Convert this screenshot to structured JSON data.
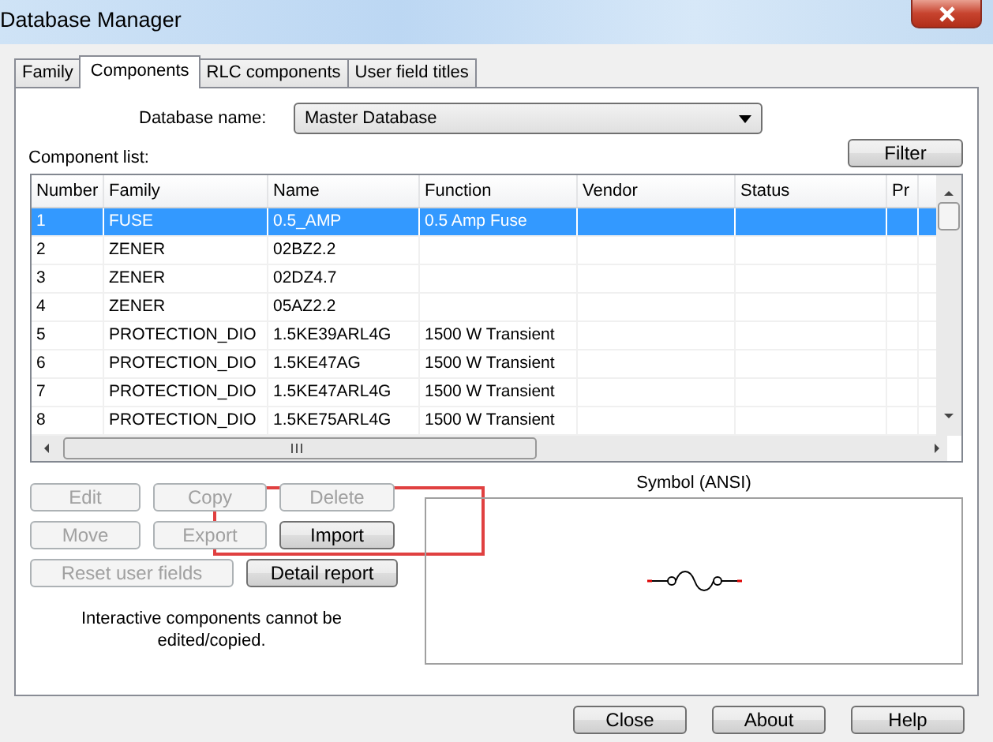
{
  "window": {
    "title": "Database Manager"
  },
  "tabs": [
    {
      "label": "Family",
      "selected": false
    },
    {
      "label": "Components",
      "selected": true
    },
    {
      "label": "RLC components",
      "selected": false
    },
    {
      "label": "User field titles",
      "selected": false
    }
  ],
  "database": {
    "label": "Database name:",
    "value": "Master Database"
  },
  "filter_button": "Filter",
  "component_list": {
    "label": "Component list:",
    "columns": [
      "Number",
      "Family",
      "Name",
      "Function",
      "Vendor",
      "Status",
      "Pr"
    ],
    "rows": [
      {
        "cells": [
          "1",
          "FUSE",
          "0.5_AMP",
          "0.5 Amp Fuse",
          "",
          "",
          ""
        ],
        "selected": true
      },
      {
        "cells": [
          "2",
          "ZENER",
          "02BZ2.2",
          "",
          "",
          "",
          ""
        ],
        "selected": false
      },
      {
        "cells": [
          "3",
          "ZENER",
          "02DZ4.7",
          "",
          "",
          "",
          ""
        ],
        "selected": false
      },
      {
        "cells": [
          "4",
          "ZENER",
          "05AZ2.2",
          "",
          "",
          "",
          ""
        ],
        "selected": false
      },
      {
        "cells": [
          "5",
          "PROTECTION_DIO",
          "1.5KE39ARL4G",
          "1500 W Transient",
          "",
          "",
          ""
        ],
        "selected": false
      },
      {
        "cells": [
          "6",
          "PROTECTION_DIO",
          "1.5KE47AG",
          "1500 W Transient",
          "",
          "",
          ""
        ],
        "selected": false
      },
      {
        "cells": [
          "7",
          "PROTECTION_DIO",
          "1.5KE47ARL4G",
          "1500 W Transient",
          "",
          "",
          ""
        ],
        "selected": false
      },
      {
        "cells": [
          "8",
          "PROTECTION_DIO",
          "1.5KE75ARL4G",
          "1500 W Transient",
          "",
          "",
          ""
        ],
        "selected": false
      }
    ]
  },
  "action_buttons": [
    [
      {
        "label": "Edit",
        "disabled": true
      },
      {
        "label": "Copy",
        "disabled": true
      },
      {
        "label": "Delete",
        "disabled": true
      }
    ],
    [
      {
        "label": "Move",
        "disabled": true
      },
      {
        "label": "Export",
        "disabled": true
      },
      {
        "label": "Import",
        "disabled": false
      }
    ],
    [
      {
        "label": "Reset user fields",
        "disabled": true
      },
      {
        "label": "Detail report",
        "disabled": false
      }
    ]
  ],
  "note": "Interactive components cannot be edited/copied.",
  "symbol": {
    "title": "Symbol (ANSI)"
  },
  "footer_buttons": [
    "Close",
    "About",
    "Help"
  ]
}
